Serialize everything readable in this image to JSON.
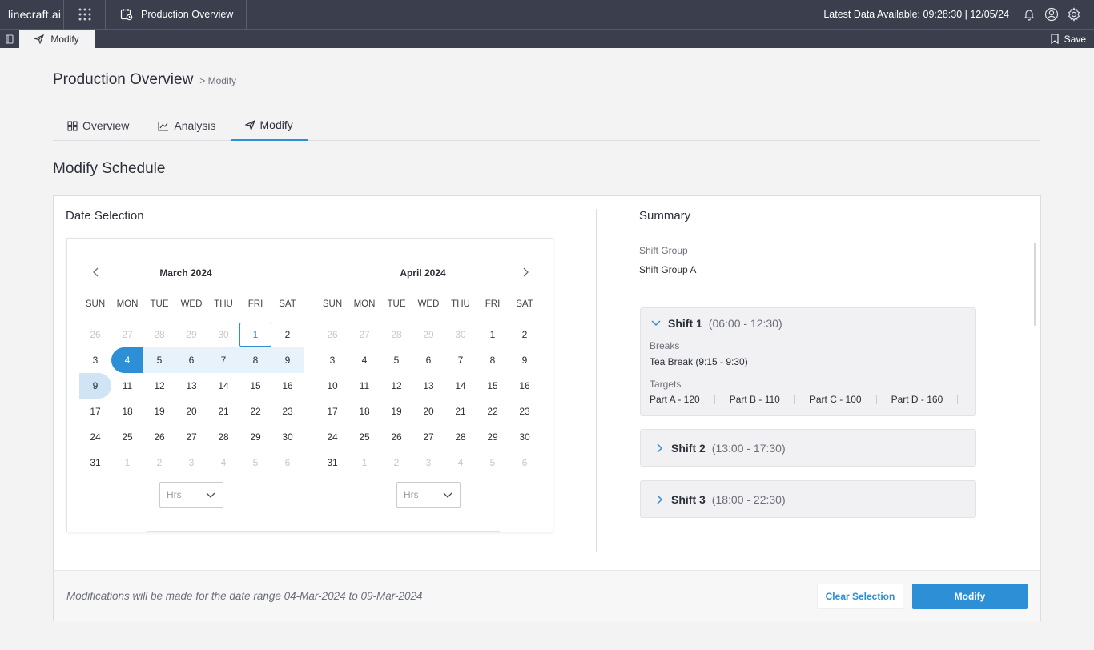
{
  "topbar": {
    "logo": "linecraft.ai",
    "app_tab": "Production Overview",
    "latest_data": "Latest Data Available: 09:28:30 | 12/05/24"
  },
  "subbar": {
    "tab": "Modify",
    "save": "Save"
  },
  "page": {
    "title": "Production Overview",
    "breadcrumb": "> Modify",
    "heading": "Modify Schedule"
  },
  "tabs": [
    {
      "label": "Overview"
    },
    {
      "label": "Analysis"
    },
    {
      "label": "Modify"
    }
  ],
  "date_selection": {
    "title": "Date Selection",
    "dow": [
      "SUN",
      "MON",
      "TUE",
      "WED",
      "THU",
      "FRI",
      "SAT"
    ],
    "months": [
      {
        "title": "March 2024",
        "hrs": "Hrs",
        "days": [
          "26",
          "27",
          "28",
          "29",
          "30",
          "1",
          "2",
          "3",
          "4",
          "5",
          "6",
          "7",
          "8",
          "9",
          "9",
          "11",
          "12",
          "13",
          "14",
          "15",
          "16",
          "17",
          "18",
          "19",
          "20",
          "21",
          "22",
          "23",
          "24",
          "25",
          "26",
          "27",
          "28",
          "29",
          "30",
          "31",
          "1",
          "2",
          "3",
          "4",
          "5",
          "6"
        ]
      },
      {
        "title": "April 2024",
        "hrs": "Hrs",
        "days": [
          "26",
          "27",
          "28",
          "29",
          "30",
          "1",
          "2",
          "3",
          "4",
          "5",
          "6",
          "7",
          "8",
          "9",
          "10",
          "11",
          "12",
          "13",
          "14",
          "15",
          "16",
          "17",
          "18",
          "19",
          "20",
          "21",
          "22",
          "23",
          "24",
          "25",
          "26",
          "27",
          "28",
          "29",
          "30",
          "31",
          "1",
          "2",
          "3",
          "4",
          "5",
          "6"
        ]
      }
    ]
  },
  "summary": {
    "title": "Summary",
    "shift_group_label": "Shift Group",
    "shift_group_value": "Shift Group A",
    "shifts": [
      {
        "name": "Shift 1",
        "time": "(06:00 - 12:30)",
        "breaks_label": "Breaks",
        "breaks": "Tea Break (9:15 - 9:30)",
        "targets_label": "Targets",
        "targets": [
          "Part A - 120",
          "Part B - 110",
          "Part C - 100",
          "Part D - 160"
        ]
      },
      {
        "name": "Shift 2",
        "time": "(13:00 - 17:30)"
      },
      {
        "name": "Shift 3",
        "time": "(18:00 - 22:30)"
      }
    ]
  },
  "footer": {
    "note": "Modifications will be made for the date range 04-Mar-2024 to 09-Mar-2024",
    "clear": "Clear Selection",
    "modify": "Modify"
  },
  "colors": {
    "accent": "#2d8fd5",
    "topbar": "#3b3f4d",
    "range": "#e7f2fb"
  }
}
